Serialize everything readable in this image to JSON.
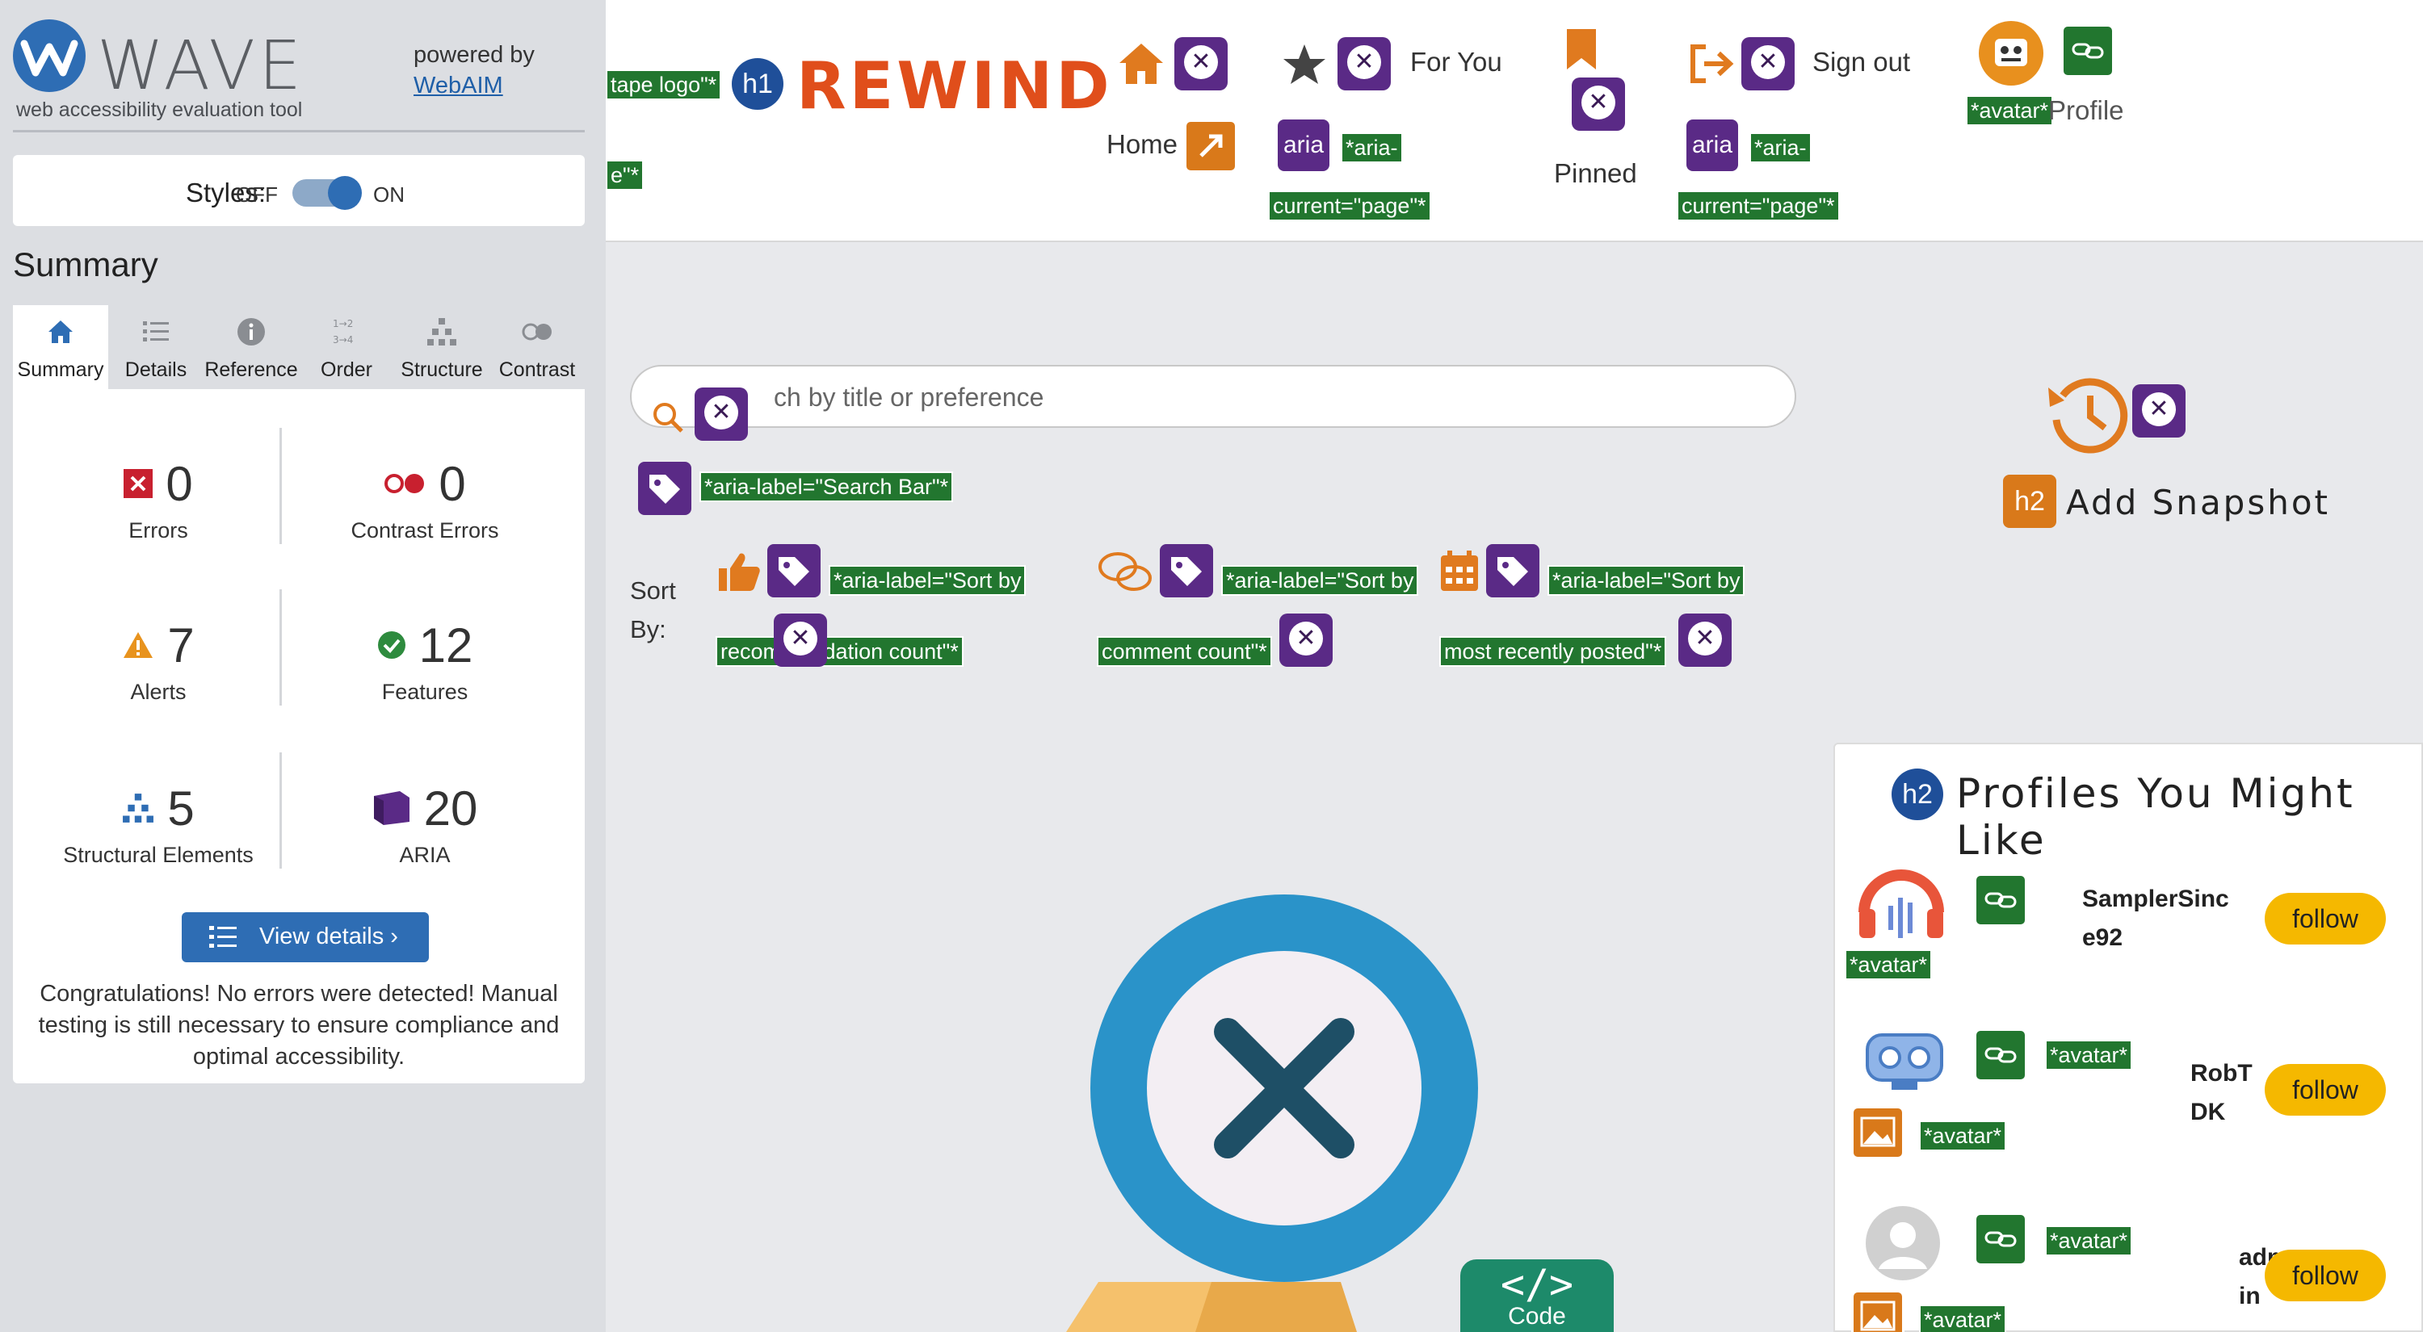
{
  "wave": {
    "logo_text": "WAVE",
    "tagline": "web accessibility evaluation tool",
    "powered_by": "powered by",
    "webaim_link": "WebAIM",
    "styles_label": "Styles:",
    "styles_off": "OFF",
    "styles_on": "ON",
    "summary_title": "Summary",
    "tabs": [
      {
        "label": "Summary",
        "icon": "home-icon"
      },
      {
        "label": "Details",
        "icon": "list-icon"
      },
      {
        "label": "Reference",
        "icon": "info-icon"
      },
      {
        "label": "Order",
        "icon": "order-icon"
      },
      {
        "label": "Structure",
        "icon": "structure-icon"
      },
      {
        "label": "Contrast",
        "icon": "contrast-icon"
      }
    ],
    "stats": {
      "errors": {
        "value": "0",
        "label": "Errors"
      },
      "contrast_errors": {
        "value": "0",
        "label": "Contrast Errors"
      },
      "alerts": {
        "value": "7",
        "label": "Alerts"
      },
      "features": {
        "value": "12",
        "label": "Features"
      },
      "structural": {
        "value": "5",
        "label": "Structural Elements"
      },
      "aria": {
        "value": "20",
        "label": "ARIA"
      }
    },
    "view_details": "View details ›",
    "congrats": "Congratulations! No errors were detected! Manual testing is still necessary to ensure compliance and optimal accessibility."
  },
  "page": {
    "logo_alt_fragment": "tape logo\"*",
    "logo_alt_fragment_2": "e\"*",
    "heading_badge": "h1",
    "logo_text": "REWIND",
    "nav": {
      "home": "Home",
      "for_you": "For You",
      "pinned": "Pinned",
      "sign_out": "Sign out",
      "profile": "Profile",
      "avatar_tag": "*avatar*",
      "aria_badge": "aria",
      "aria_tag_1": "*aria-",
      "aria_tag_2": "current=\"page\"*"
    },
    "search": {
      "placeholder": "ch by title or preference",
      "aria_label_tag": "*aria-label=\"Search Bar\"*"
    },
    "sort": {
      "label": "Sort By:",
      "recommendation_1": "*aria-label=\"Sort by",
      "recommendation_2": "recommendation count\"*",
      "comment_1": "*aria-label=\"Sort by",
      "comment_2": "comment count\"*",
      "recent_1": "*aria-label=\"Sort by",
      "recent_2": "most recently posted\"*"
    },
    "snapshot": {
      "heading_badge": "h2",
      "label": "Add Snapshot"
    },
    "profiles": {
      "heading_badge": "h2",
      "title": "Profiles You Might Like",
      "avatar_tag": "*avatar*",
      "items": [
        {
          "name_1": "SamplerSinc",
          "name_2": "e92",
          "follow": "follow"
        },
        {
          "name_1": "RobT",
          "name_2": "DK",
          "follow": "follow"
        },
        {
          "name_1": "adm",
          "name_2": "in",
          "follow": "follow"
        }
      ]
    },
    "code_badge": {
      "symbol": "</>",
      "label": "Code"
    }
  },
  "colors": {
    "wave_blue": "#2e6db4",
    "aria_purple": "#5a2a86",
    "feature_green": "#22762f",
    "alert_orange": "#d9791a",
    "brand_orange": "#e04e1b",
    "follow_yellow": "#f5b800"
  }
}
